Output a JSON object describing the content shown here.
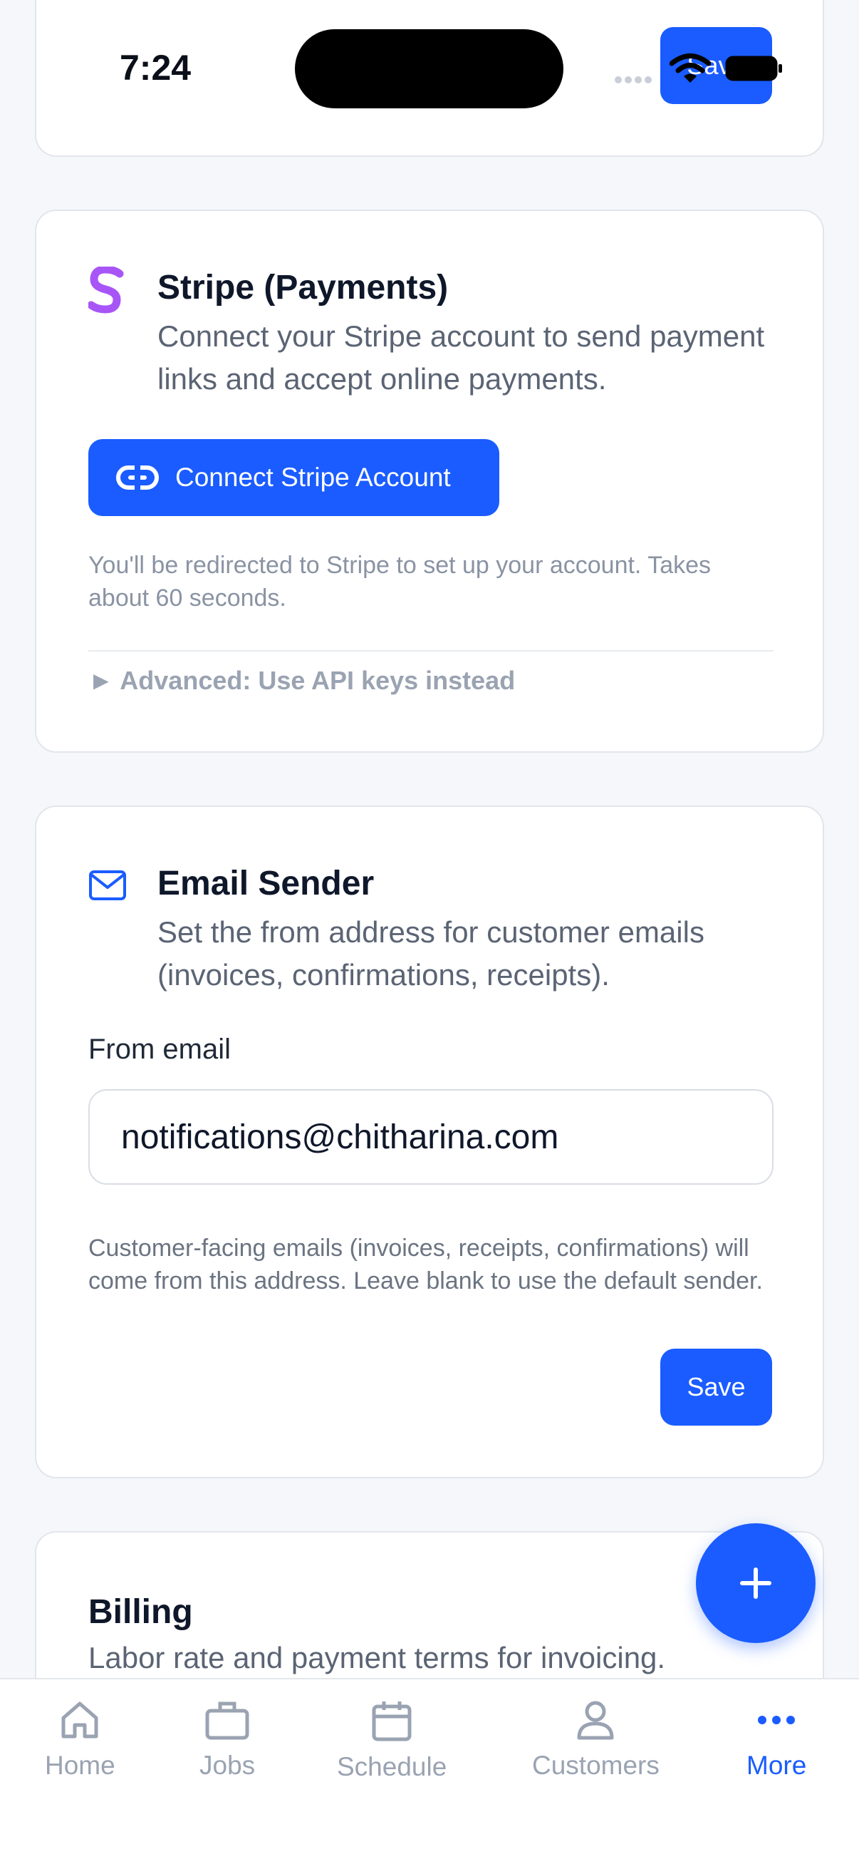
{
  "status_bar": {
    "time": "7:24",
    "save_label": "Save"
  },
  "stripe": {
    "icon_letter": "S",
    "title": "Stripe (Payments)",
    "description": "Connect your Stripe account to send payment links and accept online payments.",
    "connect_button": "Connect Stripe Account",
    "note": "You'll be redirected to Stripe to set up your account. Takes about 60 seconds.",
    "advanced_toggle": "► Advanced: Use API keys instead"
  },
  "email_sender": {
    "title": "Email Sender",
    "description": "Set the from address for customer emails (invoices, confirmations, receipts).",
    "field_label": "From email",
    "field_value": "notifications@chitharina.com",
    "help_text": "Customer-facing emails (invoices, receipts, confirmations) will come from this address. Leave blank to use the default sender.",
    "save_label": "Save"
  },
  "billing": {
    "title": "Billing",
    "description": "Labor rate and payment terms for invoicing."
  },
  "tabs": [
    {
      "label": "Home",
      "icon": "home-icon",
      "active": false
    },
    {
      "label": "Jobs",
      "icon": "briefcase-icon",
      "active": false
    },
    {
      "label": "Schedule",
      "icon": "calendar-icon",
      "active": false
    },
    {
      "label": "Customers",
      "icon": "person-icon",
      "active": false
    },
    {
      "label": "More",
      "icon": "more-dots-icon",
      "active": true
    }
  ],
  "colors": {
    "accent": "#1a5cff",
    "stripe_brand": "#a855f7",
    "background": "#f5f7fa",
    "muted_text": "#9aa3b2"
  }
}
